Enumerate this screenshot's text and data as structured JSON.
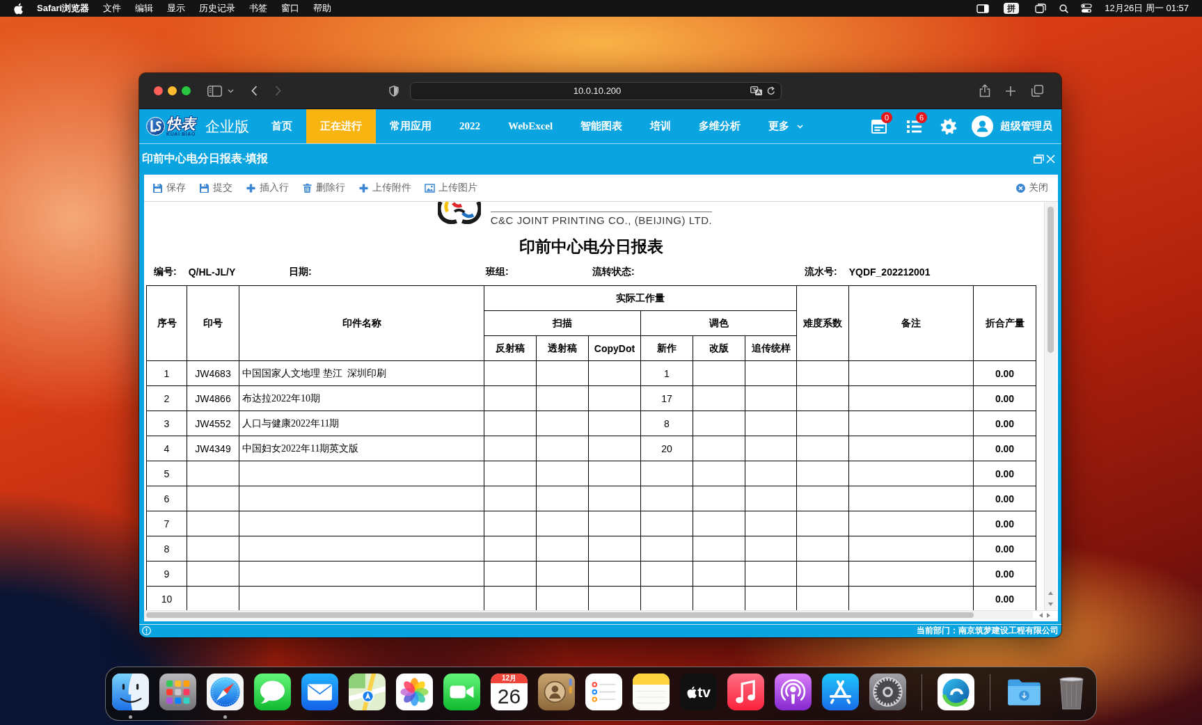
{
  "menu_bar": {
    "app_name": "Safari浏览器",
    "menus": [
      "文件",
      "编辑",
      "显示",
      "历史记录",
      "书签",
      "窗口",
      "帮助"
    ],
    "input_source": "拼",
    "clock": "12月26日 周一 01:57"
  },
  "browser": {
    "url": "10.0.10.200",
    "can_go_back": true,
    "can_go_forward": false
  },
  "app_nav": {
    "logo_text": "快表",
    "logo_subtext": "KUAI BIAO",
    "edition": "企业版",
    "items": [
      {
        "label": "首页",
        "selected": false,
        "has_menu": false
      },
      {
        "label": "正在进行",
        "selected": true,
        "has_menu": false
      },
      {
        "label": "常用应用",
        "selected": false,
        "has_menu": false
      },
      {
        "label": "2022",
        "selected": false,
        "has_menu": false
      },
      {
        "label": "WebExcel",
        "selected": false,
        "has_menu": false
      },
      {
        "label": "智能图表",
        "selected": false,
        "has_menu": false
      },
      {
        "label": "培训",
        "selected": false,
        "has_menu": false
      },
      {
        "label": "多维分析",
        "selected": false,
        "has_menu": false
      },
      {
        "label": "更多",
        "selected": false,
        "has_menu": true
      }
    ],
    "alerts": [
      {
        "kind": "document",
        "badge": "0"
      },
      {
        "kind": "list",
        "badge": "6"
      }
    ],
    "user": "超级管理员"
  },
  "dialog": {
    "title": "印前中心电分日报表-填报",
    "toolbar": [
      {
        "kind": "save",
        "label": "保存"
      },
      {
        "kind": "submit",
        "label": "提交"
      },
      {
        "kind": "insert",
        "label": "插入行"
      },
      {
        "kind": "delete",
        "label": "删除行"
      },
      {
        "kind": "attach",
        "label": "上传附件"
      },
      {
        "kind": "image",
        "label": "上传图片"
      }
    ],
    "close_label": "关闭"
  },
  "report": {
    "company": "C&C JOINT PRINTING CO., (BEIJING) LTD.",
    "title": "印前中心电分日报表",
    "fields": [
      {
        "label": "编号:",
        "value": "Q/HL-JL/Y"
      },
      {
        "label": "日期:"
      },
      {
        "label": "班组:"
      },
      {
        "label": "流转状态:"
      },
      {
        "label": "流水号:",
        "value": "YQDF_202212001"
      }
    ],
    "table": {
      "columns": [
        {
          "label": "序号"
        },
        {
          "label": "印号"
        },
        {
          "label": "印件名称"
        },
        {
          "label": "实际工作量",
          "children": [
            {
              "label": "扫描",
              "children": [
                {
                  "label": "反射稿"
                },
                {
                  "label": "透射稿"
                },
                {
                  "label": "CopyDot"
                }
              ]
            },
            {
              "label": "调色",
              "children": [
                {
                  "label": "新作"
                },
                {
                  "label": "改版"
                },
                {
                  "label": "追传统样"
                }
              ]
            }
          ]
        },
        {
          "label": "难度系数"
        },
        {
          "label": "备注"
        },
        {
          "label": "折合产量"
        }
      ],
      "rows": [
        {
          "no": "1",
          "code": "JW4683",
          "name": "中国国家人文地理 垫江  深圳印刷",
          "new": "1",
          "output": "0.00"
        },
        {
          "no": "2",
          "code": "JW4866",
          "name": "布达拉2022年10期",
          "new": "17",
          "output": "0.00"
        },
        {
          "no": "3",
          "code": "JW4552",
          "name": "人口与健康2022年11期",
          "new": "8",
          "output": "0.00"
        },
        {
          "no": "4",
          "code": "JW4349",
          "name": "中国妇女2022年11期英文版",
          "new": "20",
          "output": "0.00"
        },
        {
          "no": "5",
          "output": "0.00"
        },
        {
          "no": "6",
          "output": "0.00"
        },
        {
          "no": "7",
          "output": "0.00"
        },
        {
          "no": "8",
          "output": "0.00"
        },
        {
          "no": "9",
          "output": "0.00"
        },
        {
          "no": "10",
          "output": "0.00"
        }
      ]
    }
  },
  "status_bar": {
    "department": "当前部门：南京筑梦建设工程有限公司"
  },
  "dock": {
    "apps": [
      {
        "kind": "finder",
        "running": true
      },
      {
        "kind": "launchpad",
        "running": false
      },
      {
        "kind": "safari",
        "running": true
      },
      {
        "kind": "messages",
        "running": false
      },
      {
        "kind": "mail",
        "running": false
      },
      {
        "kind": "maps",
        "running": false
      },
      {
        "kind": "photos",
        "running": false
      },
      {
        "kind": "facetime",
        "running": false
      },
      {
        "kind": "calendar",
        "month": "12月",
        "day": "26",
        "running": false
      },
      {
        "kind": "contacts",
        "running": false
      },
      {
        "kind": "reminders",
        "running": false
      },
      {
        "kind": "notes",
        "running": false
      },
      {
        "kind": "tv",
        "label": "tv",
        "running": false
      },
      {
        "kind": "music",
        "running": false
      },
      {
        "kind": "podcasts",
        "running": false
      },
      {
        "kind": "appstore",
        "running": false
      },
      {
        "kind": "settings",
        "running": false
      }
    ],
    "recent": [
      {
        "kind": "edge",
        "running": false
      }
    ],
    "stacks": [
      {
        "kind": "downloads"
      },
      {
        "kind": "trash"
      }
    ]
  }
}
